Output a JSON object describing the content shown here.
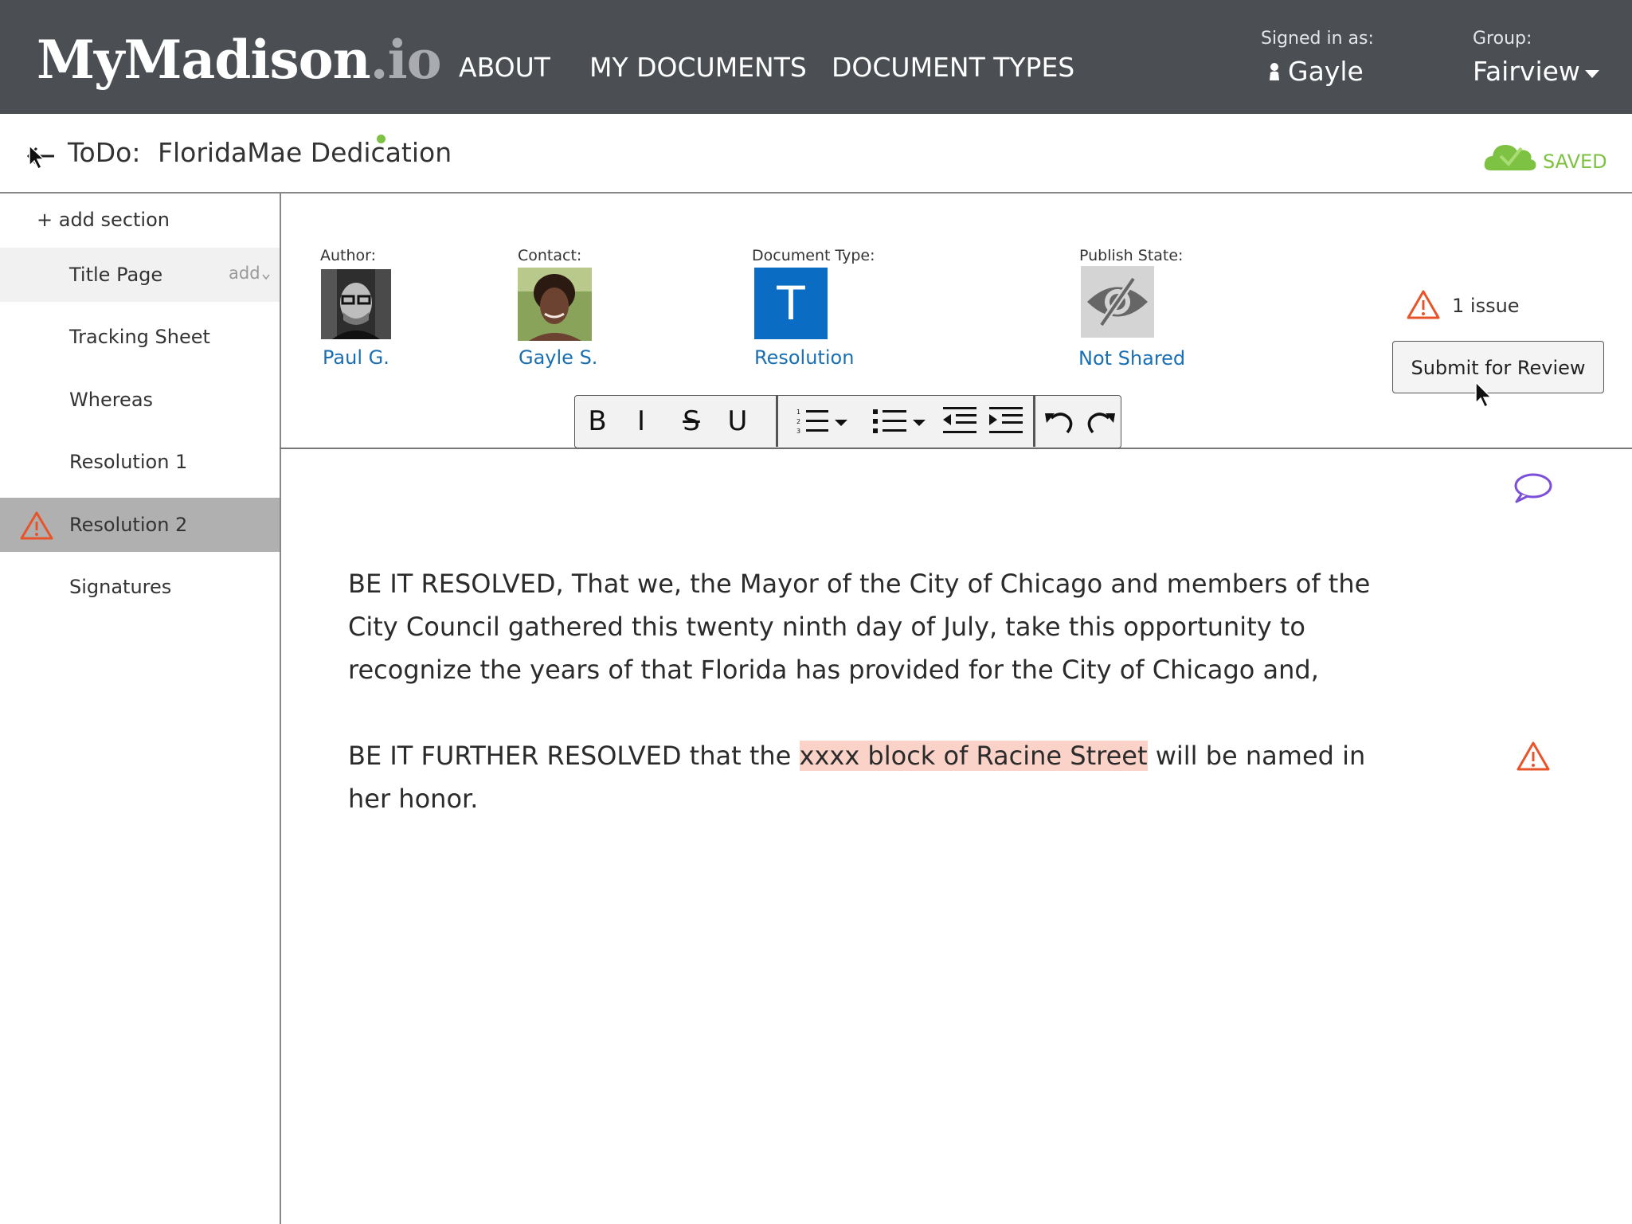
{
  "header": {
    "logo_main": "MyMadison",
    "logo_suffix": ".io",
    "nav": [
      "ABOUT",
      "MY DOCUMENTS",
      "DOCUMENT TYPES"
    ],
    "signed_in_label": "Signed in as:",
    "signed_in_user": "Gayle",
    "group_label": "Group:",
    "group_value": "Fairview"
  },
  "titlebar": {
    "todo_label": "ToDo:",
    "document_title": "FloridaMae Dedication",
    "status": "SAVED"
  },
  "sidebar": {
    "add_section": "+ add section",
    "add_hint": "add",
    "items": [
      {
        "label": "Title Page"
      },
      {
        "label": "Tracking Sheet"
      },
      {
        "label": "Whereas"
      },
      {
        "label": "Resolution 1"
      },
      {
        "label": "Resolution 2"
      },
      {
        "label": "Signatures"
      }
    ]
  },
  "meta": {
    "author_label": "Author:",
    "author_value": "Paul G.",
    "contact_label": "Contact:",
    "contact_value": "Gayle S.",
    "doctype_label": "Document Type:",
    "doctype_letter": "T",
    "doctype_value": "Resolution",
    "publish_label": "Publish State:",
    "publish_value": "Not Shared",
    "issues": "1 issue",
    "submit_label": "Submit for Review"
  },
  "toolbar": {
    "bold": "B",
    "italic": "I",
    "strike": "S",
    "underline": "U"
  },
  "content": {
    "para1": "BE IT RESOLVED, That we, the Mayor of the City of Chicago and members of the City Council gathered this twenty ninth day of July, take this opportunity to recognize the years of that Florida has provided for the City of Chicago and,",
    "para2_before": "BE IT FURTHER RESOLVED that the ",
    "para2_highlight": "xxxx block of Racine Street",
    "para2_after": " will be named in her honor."
  },
  "colors": {
    "header_bg": "#4b4f54",
    "link": "#1a6fb3",
    "saved_green": "#7dc242",
    "warning": "#e8542a",
    "comment": "#7b4fd8",
    "highlight": "#fbd2c7"
  }
}
